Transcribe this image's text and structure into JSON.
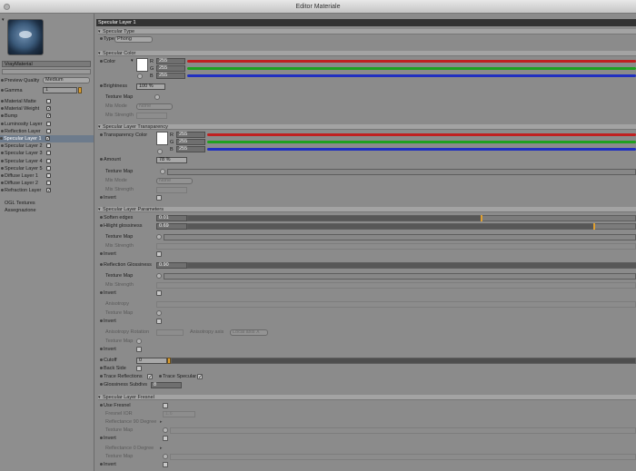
{
  "window": {
    "title": "Editor Materiale"
  },
  "sidebar": {
    "material_name": "VrayMaterial",
    "preview_quality_label": "Preview Quality",
    "preview_quality_value": "Medium",
    "gamma_label": "Gamma",
    "gamma_value": "1",
    "channels": [
      {
        "label": "Material Matte",
        "checked": false
      },
      {
        "label": "Material Weight",
        "checked": true
      },
      {
        "label": "Bump",
        "checked": true
      },
      {
        "label": "Luminosity Layer",
        "checked": false
      },
      {
        "label": "Reflection Layer",
        "checked": false
      },
      {
        "label": "Specular Layer 1",
        "checked": true
      },
      {
        "label": "Specular Layer 2",
        "checked": false
      },
      {
        "label": "Specular Layer 3",
        "checked": false
      },
      {
        "label": "Specular Layer 4",
        "checked": false
      },
      {
        "label": "Specular Layer 5",
        "checked": false
      },
      {
        "label": "Diffuse Layer 1",
        "checked": false
      },
      {
        "label": "Diffuse Layer 2",
        "checked": false
      },
      {
        "label": "Refraction Layer",
        "checked": true
      }
    ],
    "ogl_textures": "OGL Textures",
    "assignment": "Assegnazione"
  },
  "main": {
    "header": "Specular Layer 1",
    "specular_type": {
      "section": "Specular Type",
      "type_label": "Type",
      "type_value": "Phong"
    },
    "specular_color": {
      "section": "Specular Color",
      "color_label": "Color",
      "r_label": "R",
      "r_value": "255",
      "g_label": "G",
      "g_value": "255",
      "b_label": "B",
      "b_value": "255",
      "brightness_label": "Brightness",
      "brightness_value": "100 %",
      "texture_map_label": "Texture Map",
      "mix_mode_label": "Mix Mode",
      "mix_mode_value": "None",
      "mix_strength_label": "Mix Strength"
    },
    "transparency": {
      "section": "Specular Layer Transparency",
      "color_label": "Transparency Color",
      "r_label": "R",
      "r_value": "255",
      "g_label": "G",
      "g_value": "255",
      "b_label": "B",
      "b_value": "255",
      "amount_label": "Amount",
      "amount_value": "78 %",
      "amount_fraction": 0.78,
      "texture_map_label": "Texture Map",
      "mix_mode_label": "Mix Mode",
      "mix_mode_value": "None",
      "mix_strength_label": "Mix Strength",
      "invert_label": "Invert"
    },
    "parameters": {
      "section": "Specular Layer Parameters",
      "soften_edges_label": "Soften edges",
      "soften_edges_value": "0.01",
      "soften_edges_fraction": 0.01,
      "hilight_label": "Hilight glossiness",
      "hilight_value": "0.69",
      "hilight_fraction": 0.69,
      "texture_map_label": "Texture Map",
      "mix_strength_label": "Mix Strength",
      "invert_label": "Invert",
      "reflection_gloss_label": "Reflection Glossiness",
      "reflection_gloss_value": "0.90",
      "reflection_gloss_fraction": 0.9,
      "anisotropy_label": "Anisotropy",
      "anisotropy_rotation_label": "Anisotropy Rotation",
      "anisotropy_axis_label": "Anisotropy axis",
      "anisotropy_axis_value": "Local axis X",
      "cutoff_label": "Cutoff",
      "cutoff_value": "0",
      "back_side_label": "Back Side",
      "trace_reflections_label": "Trace Reflections",
      "trace_specular_label": "Trace Specular",
      "glossiness_subdivs_label": "Glossiness Subdivs",
      "glossiness_subdivs_value": "8"
    },
    "fresnel": {
      "section": "Specular Layer Fresnel",
      "use_fresnel_label": "Use Fresnel",
      "fresnel_ior_label": "Fresnel IOR",
      "fresnel_ior_value": "1.6",
      "reflectance_90_label": "Reflectance 90 Degree",
      "texture_map_label": "Texture Map",
      "invert_label": "Invert",
      "reflectance_0_label": "Reflectance   0 Degree"
    }
  },
  "colors": {
    "red_line": "#c02020",
    "green_line": "#20a020",
    "blue_line": "#2030c0",
    "header_bg": "#333333",
    "accent_knob": "#e0a030"
  }
}
